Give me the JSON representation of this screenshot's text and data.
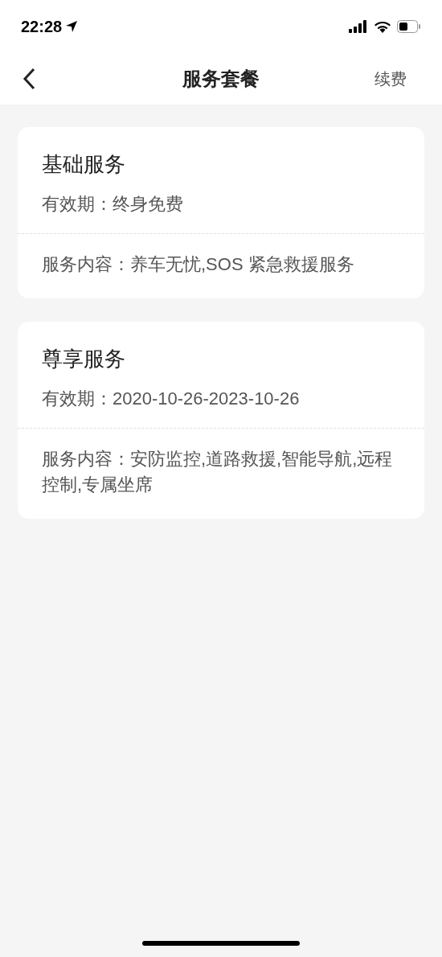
{
  "status_bar": {
    "time": "22:28"
  },
  "nav": {
    "title": "服务套餐",
    "action": "续费"
  },
  "packages": [
    {
      "name": "基础服务",
      "validity": "有效期：终身免费",
      "content": "服务内容：养车无忧,SOS 紧急救援服务"
    },
    {
      "name": "尊享服务",
      "validity": "有效期：2020-10-26-2023-10-26",
      "content": "服务内容：安防监控,道路救援,智能导航,远程控制,专属坐席"
    }
  ]
}
